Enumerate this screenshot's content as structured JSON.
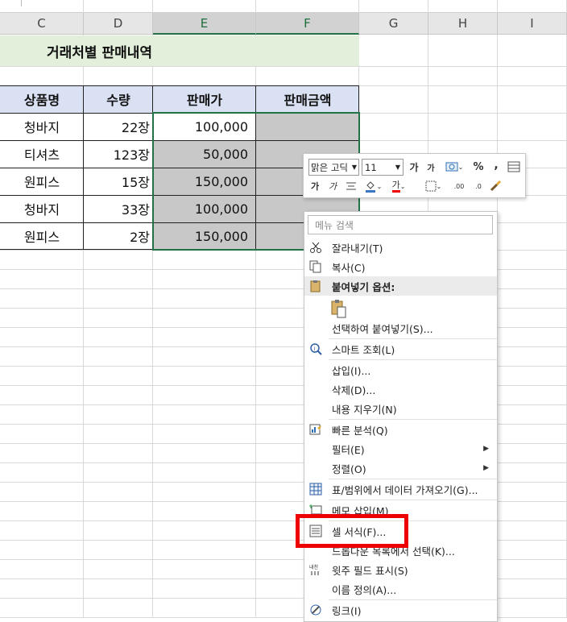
{
  "columns": [
    "C",
    "D",
    "E",
    "F",
    "G",
    "H",
    "I"
  ],
  "sheet": {
    "title": "거래처별 판매내역",
    "headers": [
      "상품명",
      "수량",
      "판매가",
      "판매금액"
    ],
    "rows": [
      {
        "product": "청바지",
        "qty": "22장",
        "price": "100,000"
      },
      {
        "product": "티셔츠",
        "qty": "123장",
        "price": "50,000"
      },
      {
        "product": "원피스",
        "qty": "15장",
        "price": "150,000"
      },
      {
        "product": "청바지",
        "qty": "33장",
        "price": "100,000"
      },
      {
        "product": "원피스",
        "qty": "2장",
        "price": "150,000"
      }
    ]
  },
  "mini_toolbar": {
    "font": "맑은 고딕",
    "font_size": "11",
    "grow_font": "가",
    "shrink_font": "가",
    "percent": "%",
    "comma": ",",
    "bold": "가",
    "italic": "가",
    "font_color": "가",
    "inc_decimal": ".00",
    "dec_decimal": ".0"
  },
  "menu": {
    "search_placeholder": "메뉴 검색",
    "items": {
      "cut": "잘라내기(T)",
      "copy": "복사(C)",
      "paste_options": "붙여넣기 옵션:",
      "paste_special": "선택하여 붙여넣기(S)...",
      "smart_lookup": "스마트 조회(L)",
      "insert": "삽입(I)...",
      "delete": "삭제(D)...",
      "clear": "내용 지우기(N)",
      "quick_analysis": "빠른 분석(Q)",
      "filter": "필터(E)",
      "sort": "정렬(O)",
      "get_data": "표/범위에서 데이터 가져오기(G)...",
      "insert_comment": "메모 삽입(M)",
      "format_cells": "셀 서식(F)...",
      "pick_from_list": "드롭다운 목록에서 선택(K)...",
      "phonetic": "윗주 필드 표시(S)",
      "define_name": "이름 정의(A)...",
      "link": "링크(I)"
    }
  },
  "colors": {
    "selection": "#217346",
    "header_fill": "#d9e1f2",
    "title_fill": "#e2efda",
    "highlight_box": "#ee0000"
  }
}
